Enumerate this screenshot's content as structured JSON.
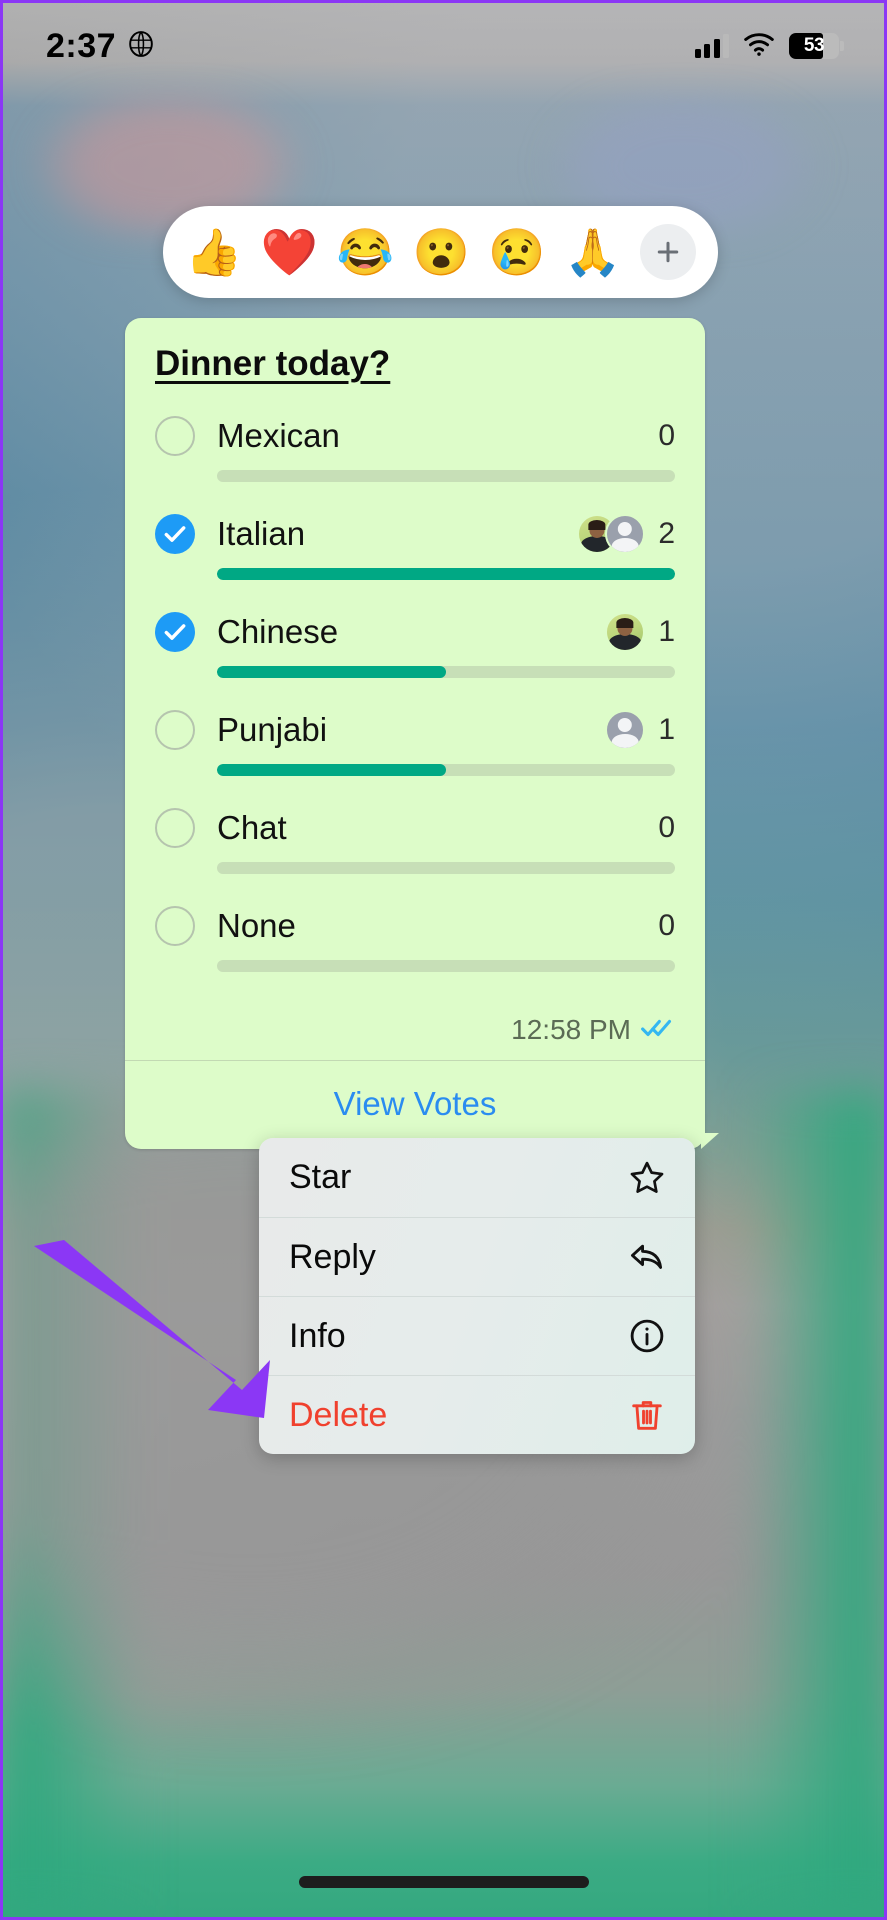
{
  "status_bar": {
    "time": "2:37",
    "location_icon": "globe-icon",
    "signal_icon": "cellular-bars-icon",
    "wifi_icon": "wifi-icon",
    "battery_percent": "53",
    "battery_icon": "battery-icon"
  },
  "reaction_bar": {
    "emojis": [
      {
        "name": "thumbs-up-reaction",
        "glyph": "👍"
      },
      {
        "name": "heart-reaction",
        "glyph": "❤️"
      },
      {
        "name": "tears-of-joy-reaction",
        "glyph": "😂"
      },
      {
        "name": "open-mouth-reaction",
        "glyph": "😮"
      },
      {
        "name": "crying-face-reaction",
        "glyph": "😢"
      },
      {
        "name": "folded-hands-reaction",
        "glyph": "🙏"
      }
    ],
    "add_label": "plus-icon"
  },
  "poll": {
    "title": "Dinner today?",
    "time": "12:58 PM",
    "read_status_icon": "double-check-read-icon",
    "view_votes_label": "View Votes",
    "options": [
      {
        "label": "Mexican",
        "count": "0",
        "selected": false,
        "percent": 0,
        "voters": []
      },
      {
        "label": "Italian",
        "count": "2",
        "selected": true,
        "percent": 100,
        "voters": [
          "photo",
          "placeholder"
        ]
      },
      {
        "label": "Chinese",
        "count": "1",
        "selected": true,
        "percent": 50,
        "voters": [
          "photo"
        ]
      },
      {
        "label": "Punjabi",
        "count": "1",
        "selected": false,
        "percent": 50,
        "voters": [
          "placeholder"
        ]
      },
      {
        "label": "Chat",
        "count": "0",
        "selected": false,
        "percent": 0,
        "voters": []
      },
      {
        "label": "None",
        "count": "0",
        "selected": false,
        "percent": 0,
        "voters": []
      }
    ]
  },
  "context_menu": {
    "items": [
      {
        "label": "Star",
        "icon": "star-outline-icon",
        "danger": false
      },
      {
        "label": "Reply",
        "icon": "reply-arrow-icon",
        "danger": false
      },
      {
        "label": "Info",
        "icon": "info-circle-icon",
        "danger": false
      },
      {
        "label": "Delete",
        "icon": "trash-icon",
        "danger": true
      }
    ]
  },
  "annotation": {
    "arrow_color": "#8b37f5",
    "points_to": "Delete"
  },
  "colors": {
    "bubble_green": "#ddfcc9",
    "bar_filled": "#00a884",
    "bar_empty": "#c7dfb7",
    "selected_radio": "#1d9bf6",
    "link_blue": "#2a8cf0",
    "delete_red": "#f0412e",
    "frame_purple": "#8b37f5"
  }
}
